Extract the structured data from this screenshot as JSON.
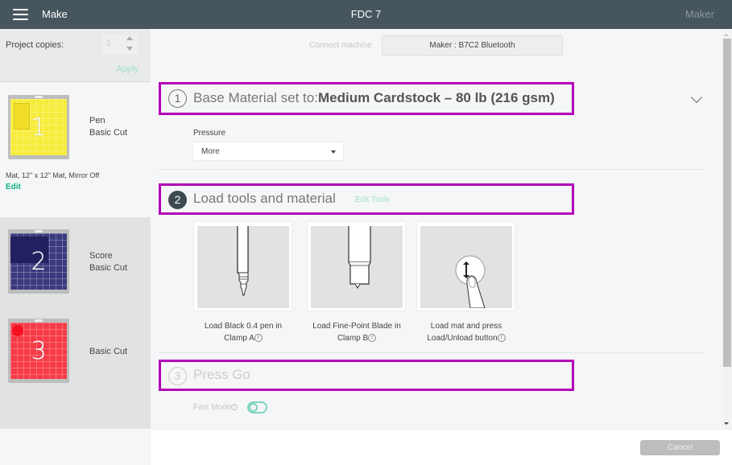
{
  "header": {
    "app_title": "Make",
    "document_title": "FDC 7",
    "machine_label": "Maker"
  },
  "left_panel": {
    "copies_label": "Project copies:",
    "copies_value": "1",
    "apply_label": "Apply",
    "mats": [
      {
        "number": "1",
        "lines": [
          "Pen",
          "Basic Cut"
        ],
        "color": "#f7ec3b",
        "meta": "Mat, 12\" x 12\" Mat, Mirror Off",
        "edit_label": "Edit",
        "selected": true
      },
      {
        "number": "2",
        "lines": [
          "Score",
          "Basic Cut"
        ],
        "color": "#3b3a7e",
        "selected": false
      },
      {
        "number": "3",
        "lines": [
          "Basic Cut"
        ],
        "color": "#f73b47",
        "selected": false
      }
    ]
  },
  "main": {
    "connect_label": "Connect machine",
    "machine_button": "Maker : B7C2 Bluetooth",
    "steps": [
      {
        "number": "1",
        "title_prefix": "Base Material set to:",
        "title_bold": "Medium Cardstock – 80 lb (216 gsm)"
      },
      {
        "number": "2",
        "title": "Load tools and material",
        "link": "Edit Tools"
      },
      {
        "number": "3",
        "title": "Press Go"
      }
    ],
    "pressure": {
      "label": "Pressure",
      "value": "More"
    },
    "tools": [
      {
        "line1": "Load Black 0.4 pen in",
        "line2": "Clamp A",
        "icon": "pen-tool-icon"
      },
      {
        "line1": "Load Fine-Point Blade in",
        "line2": "Clamp B",
        "icon": "blade-tool-icon"
      },
      {
        "line1": "Load mat and press",
        "line2": "Load/Unload button",
        "icon": "load-unload-button-icon"
      }
    ],
    "info_glyph": "i",
    "fast_mode": {
      "label": "Fast Mode",
      "enabled": false
    }
  },
  "footer": {
    "cancel_label": "Cancel"
  },
  "colors": {
    "header_bg": "#47555e",
    "accent_teal": "#11b28a",
    "highlight_box": "#b300b8"
  }
}
